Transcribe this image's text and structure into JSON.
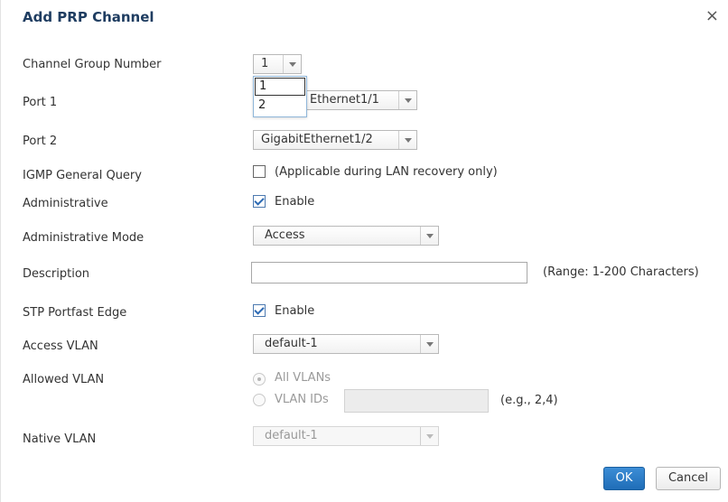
{
  "dialog": {
    "title": "Add PRP Channel",
    "close_glyph": "×"
  },
  "fields": {
    "channel_group": {
      "label": "Channel Group Number",
      "value": "1",
      "options": [
        "1",
        "2"
      ]
    },
    "port1": {
      "label": "Port 1",
      "value": "GigabitEthernet1/1",
      "visible_value": "Ethernet1/1"
    },
    "port2": {
      "label": "Port 2",
      "value": "GigabitEthernet1/2"
    },
    "igmp": {
      "label": "IGMP General Query",
      "checked": false,
      "text": "(Applicable during LAN recovery only)"
    },
    "administrative": {
      "label": "Administrative",
      "checked": true,
      "text": "Enable"
    },
    "admin_mode": {
      "label": "Administrative Mode",
      "value": "Access"
    },
    "description": {
      "label": "Description",
      "value": "",
      "hint": "(Range: 1-200 Characters)"
    },
    "stp": {
      "label": "STP Portfast Edge",
      "checked": true,
      "text": "Enable"
    },
    "access_vlan": {
      "label": "Access VLAN",
      "value": "default-1"
    },
    "allowed_vlan": {
      "label": "Allowed VLAN",
      "option_all": "All VLANs",
      "option_ids": "VLAN IDs",
      "selected": "All VLANs",
      "ids_value": "",
      "hint": "(e.g., 2,4)"
    },
    "native_vlan": {
      "label": "Native VLAN",
      "value": "default-1"
    }
  },
  "buttons": {
    "ok": "OK",
    "cancel": "Cancel"
  },
  "colors": {
    "title": "#1f3d61",
    "ok_button": "#2a7cc7",
    "dropdown_border": "#8fb6d9",
    "check": "#2c6ab4"
  },
  "icons": {
    "close": "close-icon",
    "dropdown": "chevron-down-icon",
    "check": "checkmark-icon"
  }
}
